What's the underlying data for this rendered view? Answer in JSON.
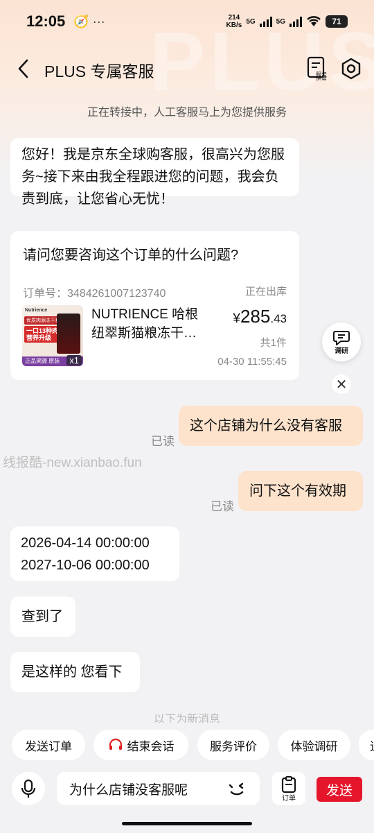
{
  "status_bar": {
    "time": "12:05",
    "extra_icons": "🧭 ···",
    "net_speed_value": "214",
    "net_speed_unit": "KB/s",
    "sim1": "5G",
    "sim2": "5G",
    "battery": "71"
  },
  "header": {
    "title": "PLUS 专属客服",
    "progress_label": "服务进度",
    "watermark": "PLUS"
  },
  "chat": {
    "transfer_notice": "正在转接中，人工客服马上为您提供服务",
    "welcome": "您好！我是京东全球购客服，很高兴为您服务~接下来由我全程跟进您的问题，我会负责到底，让您省心无忧！",
    "order_question": "请问您要咨询这个订单的什么问题?",
    "order": {
      "number_label": "订单号：",
      "number": "3484261007123740",
      "status": "正在出库",
      "product_name_line1": "NUTRIENCE 哈根",
      "product_name_line2": "纽翠斯猫粮冻干…",
      "price_currency": "¥",
      "price_int": "285",
      "price_dec": ".43",
      "count": "共1件",
      "time": "04-30 11:55:45",
      "image": {
        "brand": "Nutrience",
        "tag1": "优质肉源冻干粮",
        "tag2": "一口13种肉\n营养升级",
        "bottom": "正品溯源 原装",
        "qty": "x1"
      }
    },
    "user_msg_1": "这个店铺为什么没有客服",
    "user_msg_2": "问下这个有效期",
    "read_label": "已读",
    "agent_dates_1": "2026-04-14 00:00:00",
    "agent_dates_2": "2027-10-06 00:00:00",
    "agent_reply_1": "查到了",
    "agent_reply_2": "是这样的 您看下",
    "new_msg_hint": "以下为新消息",
    "watermark_text": "线报酷-new.xianbao.fun",
    "survey_label": "调研",
    "close_symbol": "✕"
  },
  "quick_actions": [
    "发送订单",
    "结束会话",
    "服务评价",
    "体验调研",
    "追"
  ],
  "input": {
    "value": "为什么店铺没客服呢",
    "order_label": "订单",
    "send_label": "发送"
  },
  "colors": {
    "send": "#e5162b",
    "user_bubble": "#fde2cc",
    "header_gradient": "#fbe3d3"
  }
}
